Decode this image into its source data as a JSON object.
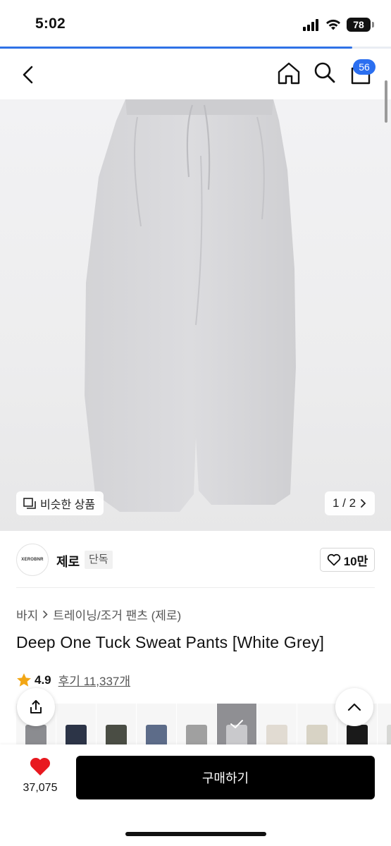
{
  "status_bar": {
    "time": "5:02",
    "battery": "78",
    "load_progress": 0.9
  },
  "nav": {
    "icons": [
      "chevron-left-icon",
      "home-icon",
      "search-icon",
      "shopping-bag-icon"
    ],
    "cart_count": "56"
  },
  "image": {
    "similar_label": "비슷한 상품",
    "page_indicator": "1 / 2"
  },
  "brand": {
    "logo_text": "XEROBNR",
    "name": "제로",
    "badge": "단독",
    "like_count": "10만"
  },
  "product": {
    "breadcrumb": [
      "바지",
      "트레이닝/조거 팬츠 (제로)"
    ],
    "title": "Deep One Tuck Sweat Pants [White Grey]",
    "rating": "4.9",
    "review_label": "후기 11,337개"
  },
  "swatches": [
    {
      "color": "#8b8c90",
      "selected": false
    },
    {
      "color": "#2c3447",
      "selected": false
    },
    {
      "color": "#4a4d44",
      "selected": false
    },
    {
      "color": "#5d6c89",
      "selected": false
    },
    {
      "color": "#a0a0a0",
      "selected": false
    },
    {
      "color": "#c9c9cc",
      "selected": true
    },
    {
      "color": "#e1dbd2",
      "selected": false
    },
    {
      "color": "#d8d3c5",
      "selected": false
    },
    {
      "color": "#1a1a1a",
      "selected": false
    },
    {
      "color": "#d7d8d5",
      "selected": false
    }
  ],
  "colors": {
    "accent": "#2b6ff0",
    "heart": "#e8191f",
    "buy_button": "#000000"
  },
  "bottom_bar": {
    "wishlist_count": "37,075",
    "buy_label": "구매하기"
  }
}
